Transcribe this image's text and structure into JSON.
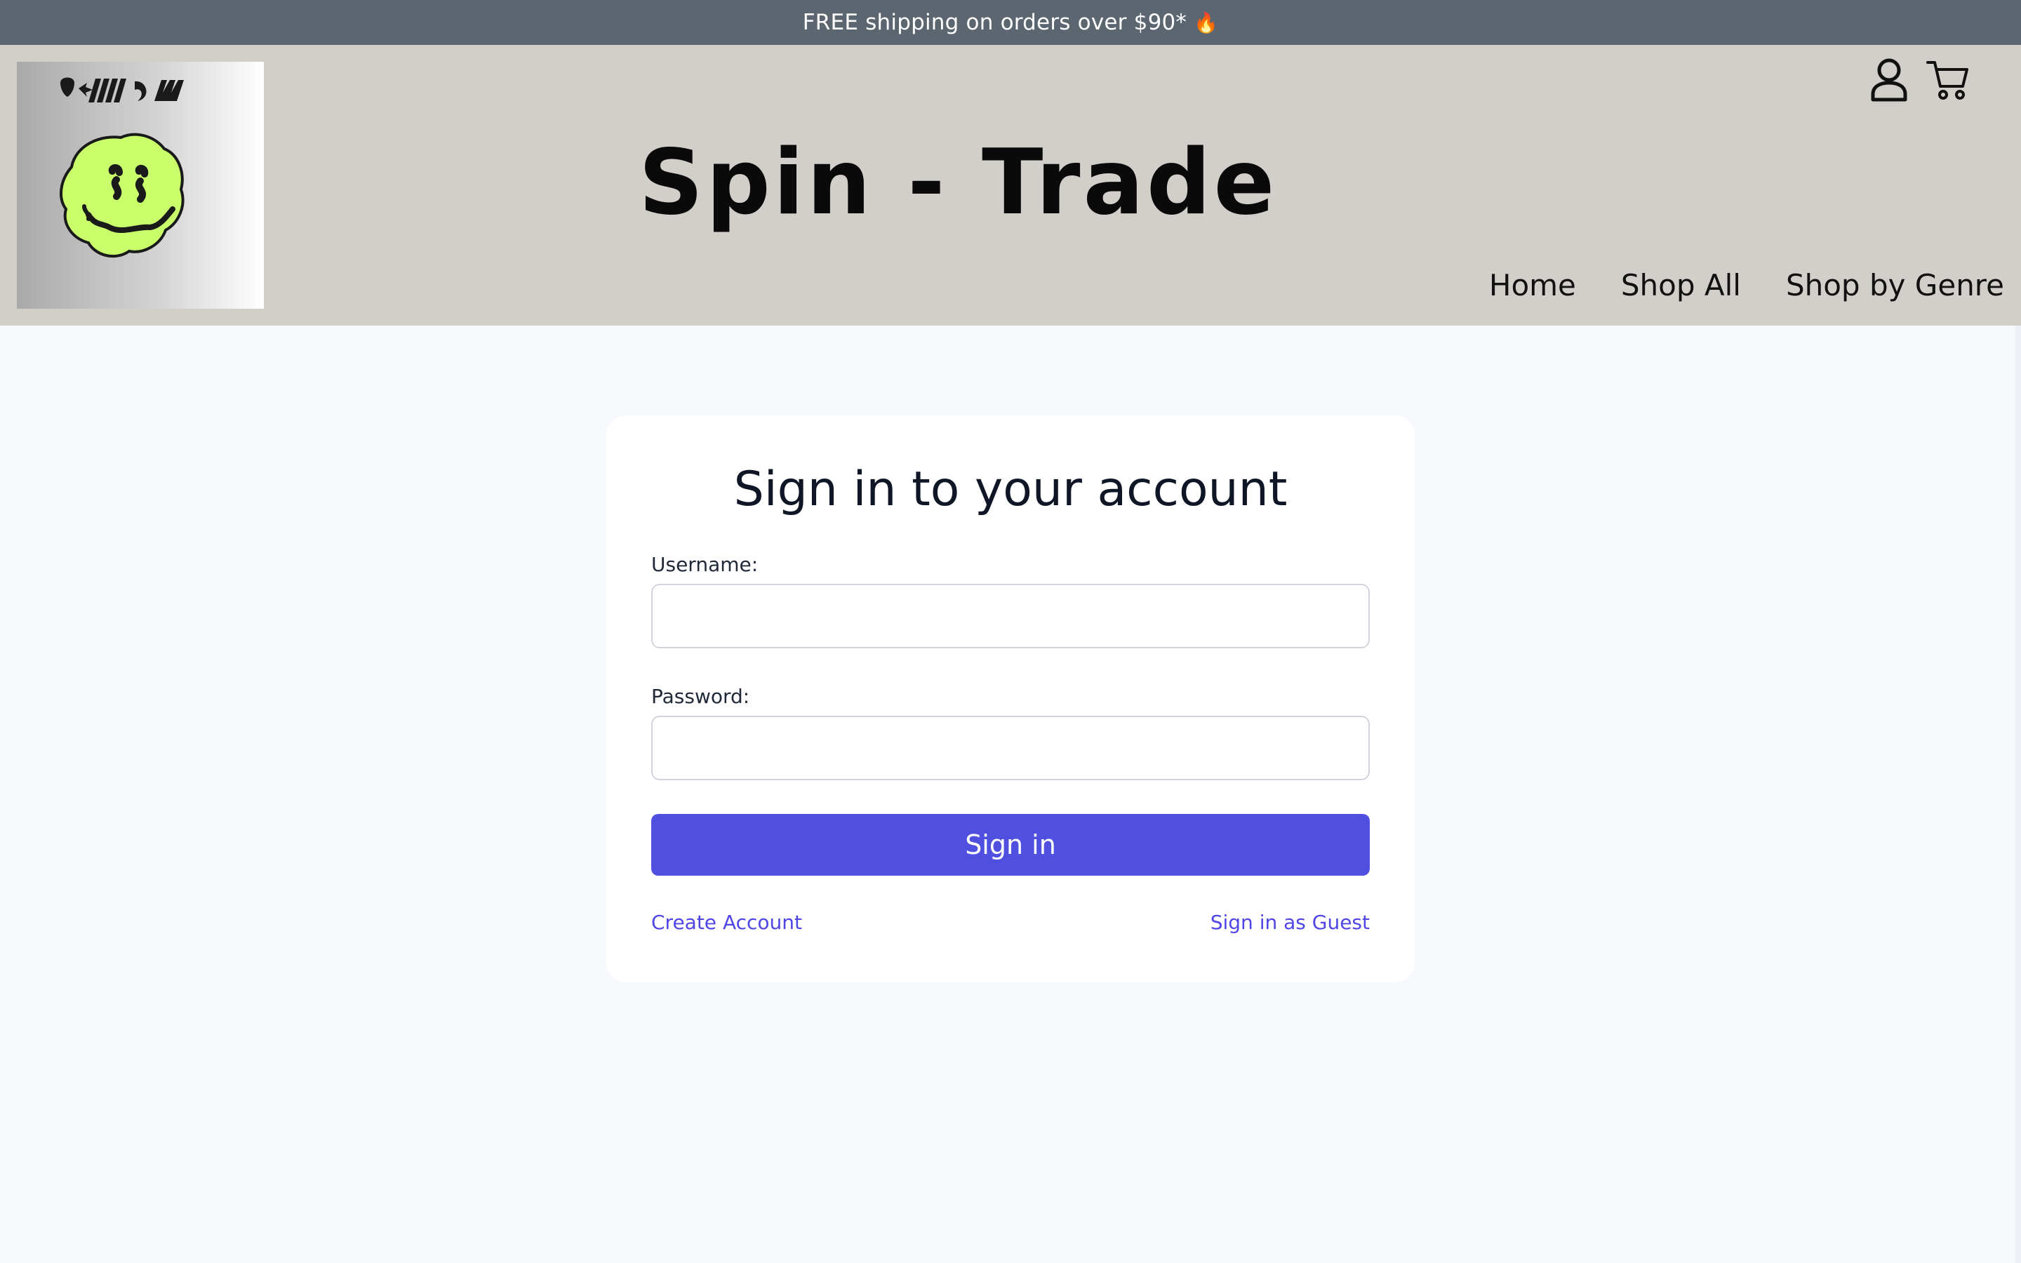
{
  "promo": {
    "text": "FREE shipping on orders over $90*",
    "emoji": "🔥"
  },
  "header": {
    "title": "Spin - Trade",
    "logo_glyphs": "",
    "icons": {
      "account": "user-icon",
      "cart": "cart-icon"
    },
    "nav": [
      "Home",
      "Shop All",
      "Shop by Genre"
    ]
  },
  "signin": {
    "heading": "Sign in to your account",
    "username_label": "Username:",
    "username_value": "",
    "password_label": "Password:",
    "password_value": "",
    "submit_label": "Sign in",
    "create_account": "Create Account",
    "guest": "Sign in as Guest"
  },
  "colors": {
    "promo_bg": "#5c6670",
    "header_bg": "#d2cfca",
    "page_bg": "#f7f9fd",
    "accent": "#4f4fe0",
    "link": "#4f46e5",
    "smiley": "#c8ff6a"
  }
}
